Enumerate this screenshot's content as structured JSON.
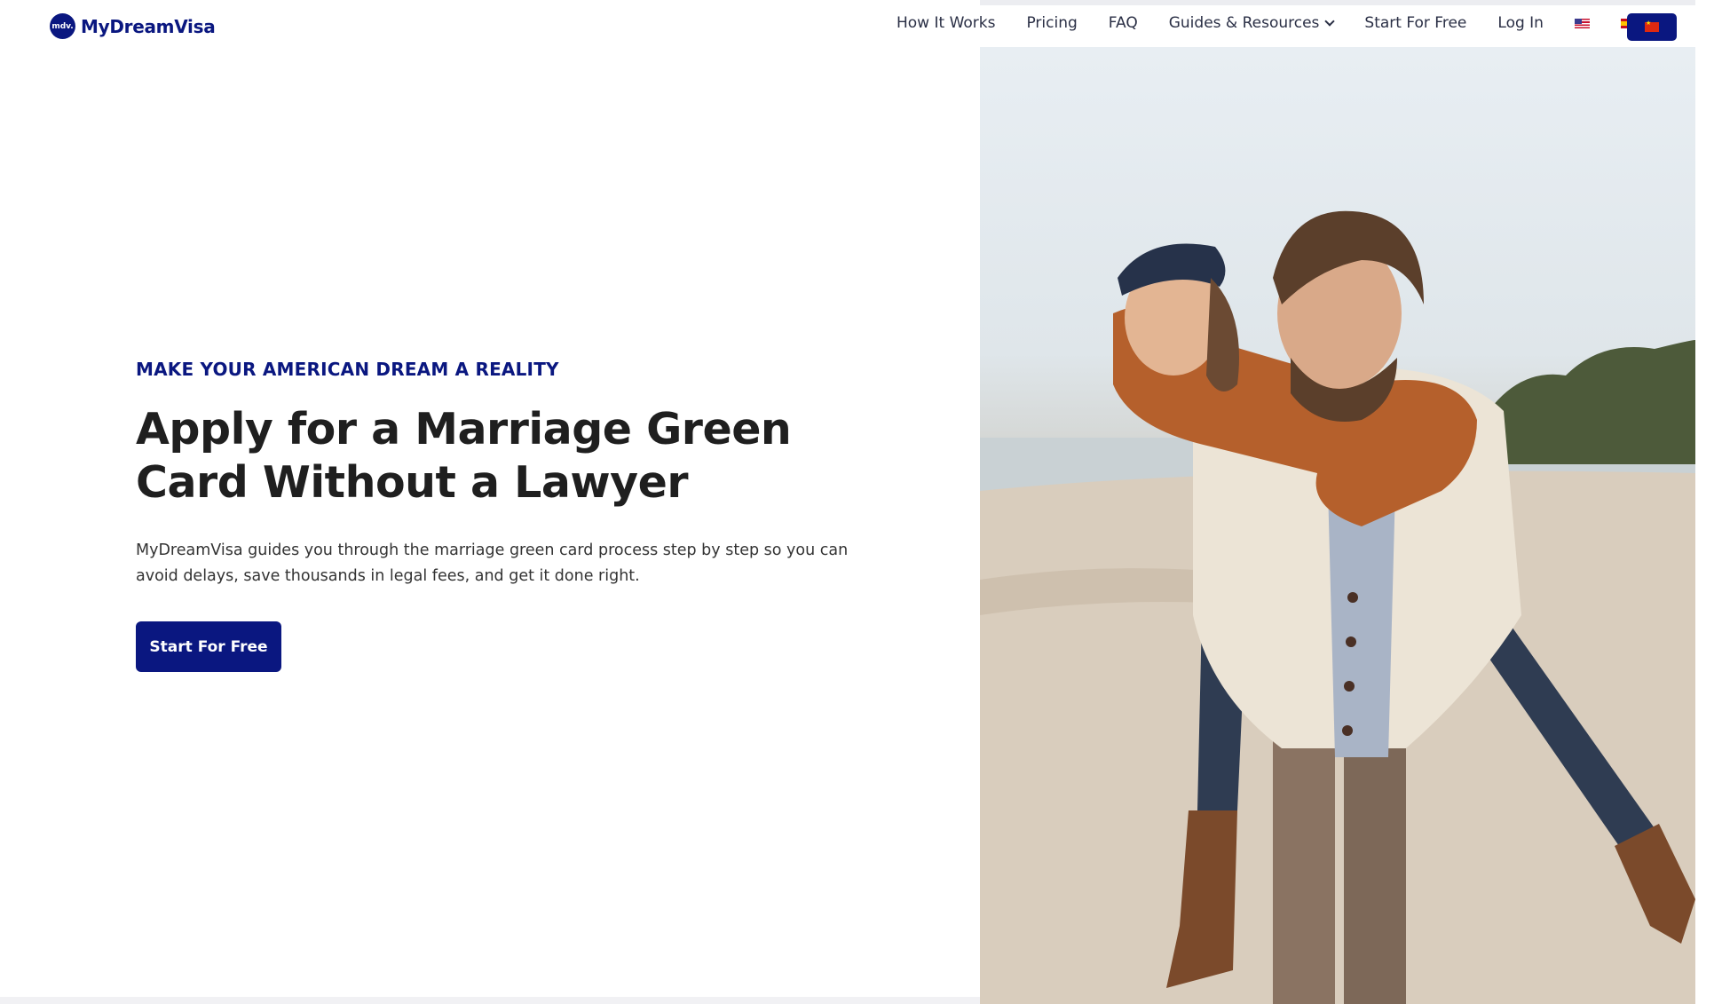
{
  "header": {
    "logo_badge": "mdv.",
    "logo_text": "MyDreamVisa",
    "nav": [
      {
        "label": "How It Works"
      },
      {
        "label": "Pricing"
      },
      {
        "label": "FAQ"
      },
      {
        "label": "Guides & Resources"
      },
      {
        "label": "Start For Free"
      },
      {
        "label": "Log In"
      }
    ],
    "flags": [
      "us-flag-icon",
      "es-flag-icon",
      "cn-flag-icon"
    ]
  },
  "hero": {
    "eyebrow": "MAKE YOUR AMERICAN DREAM A REALITY",
    "headline": "Apply for a Marriage Green Card Without a Lawyer",
    "subtext": "MyDreamVisa guides you through the marriage green card process step by step so you can avoid delays, save thousands in legal fees, and get it done right.",
    "cta_label": "Start For Free"
  },
  "colors": {
    "brand": "#0a1780",
    "text": "#1f1f1f"
  }
}
